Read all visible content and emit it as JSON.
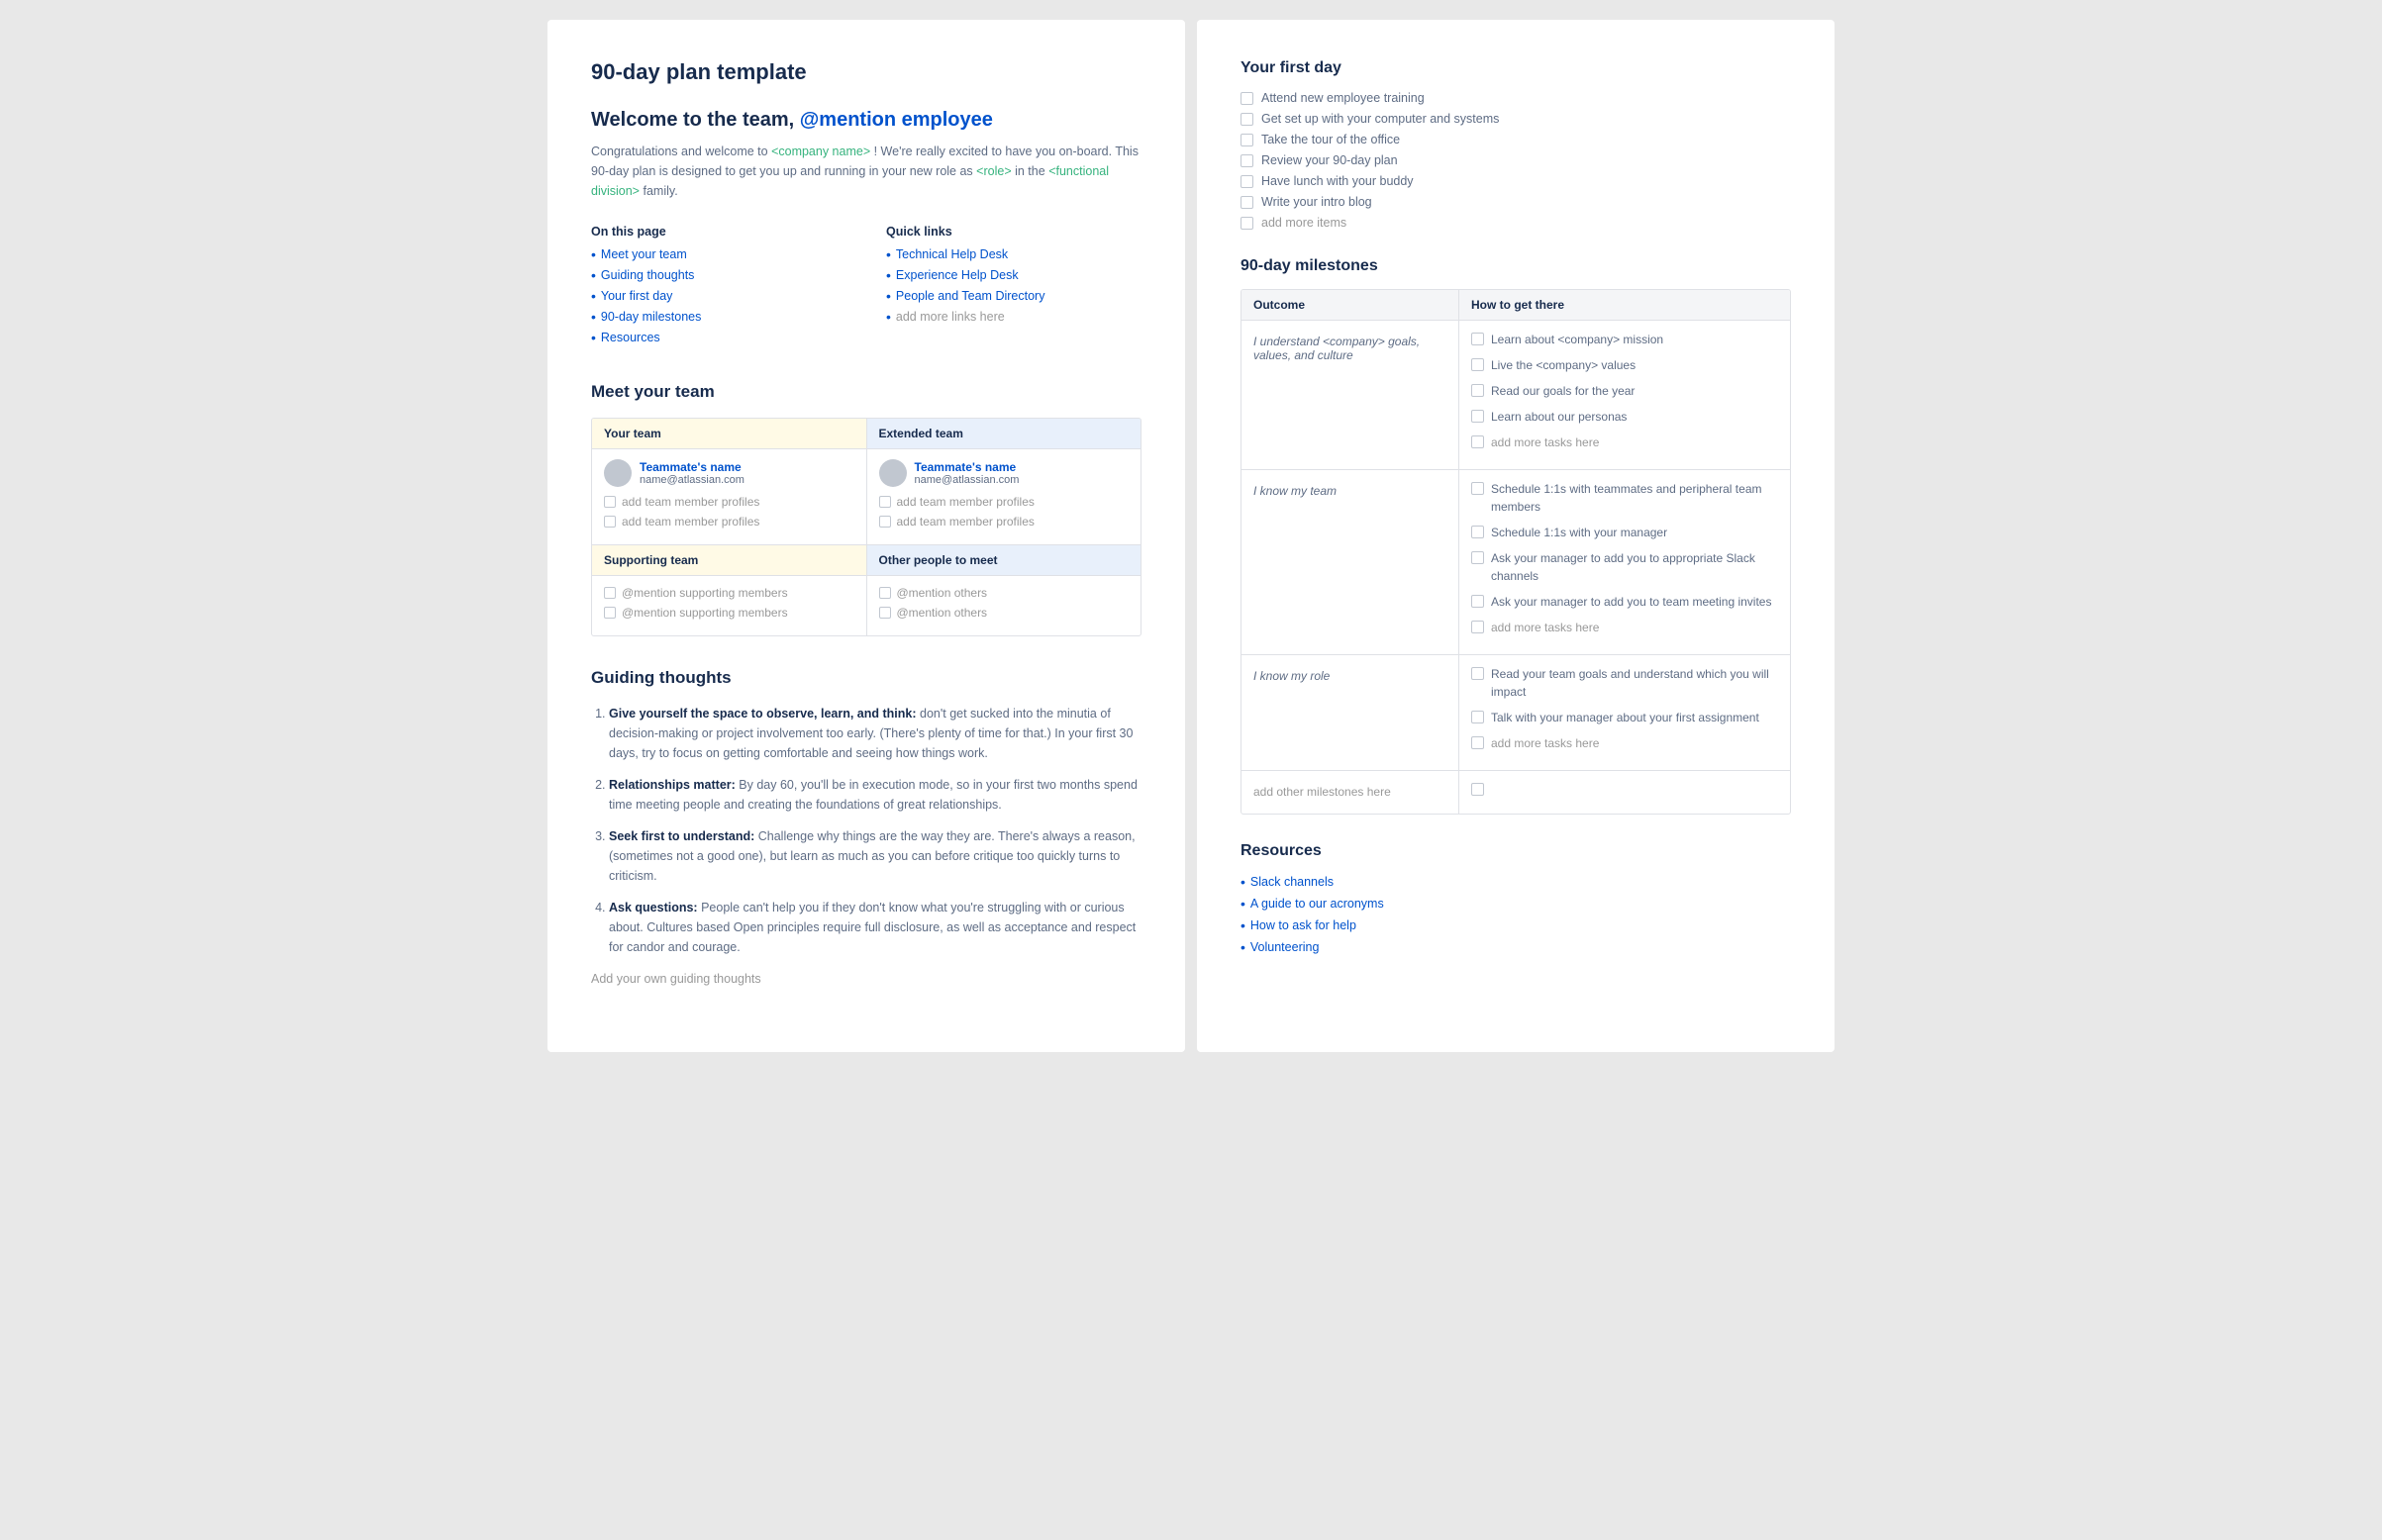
{
  "left": {
    "main_title": "90-day plan template",
    "welcome_title": "Welcome to the team,",
    "welcome_mention": "@mention employee",
    "welcome_desc_1": "Congratulations and welcome to",
    "welcome_tpl_company": "<company name>",
    "welcome_desc_2": "! We're really excited to have you on-board. This 90-day plan is designed to get you up and running in your new role as",
    "welcome_tpl_role": "<role>",
    "welcome_desc_3": "in the",
    "welcome_tpl_division": "<functional division>",
    "welcome_desc_4": "family.",
    "on_this_page_title": "On this page",
    "on_this_page_links": [
      {
        "label": "Meet your team"
      },
      {
        "label": "Guiding thoughts"
      },
      {
        "label": "Your first day"
      },
      {
        "label": "90-day milestones"
      },
      {
        "label": "Resources"
      }
    ],
    "quick_links_title": "Quick links",
    "quick_links": [
      {
        "label": "Technical Help Desk"
      },
      {
        "label": "Experience Help Desk"
      },
      {
        "label": "People and Team Directory"
      },
      {
        "label": "add more links here",
        "muted": true
      }
    ],
    "meet_your_team_title": "Meet your team",
    "team": {
      "your_team_label": "Your team",
      "extended_team_label": "Extended team",
      "supporting_team_label": "Supporting team",
      "other_people_label": "Other people to meet",
      "member1_name": "Teammate's name",
      "member1_email": "name@atlassian.com",
      "member2_name": "Teammate's name",
      "member2_email": "name@atlassian.com",
      "add_member1": "add team member profiles",
      "add_member2": "add team member profiles",
      "mention_support1": "@mention supporting members",
      "mention_support2": "@mention supporting members",
      "mention_other1": "@mention others",
      "mention_other2": "@mention others"
    },
    "guiding_thoughts_title": "Guiding thoughts",
    "guiding_items": [
      {
        "bold": "Give yourself the space to observe, learn, and think:",
        "text": " don't get sucked into the minutia of decision-making or project involvement too early. (There's plenty of time for that.) In your first 30 days, try to focus on getting comfortable and seeing how things work."
      },
      {
        "bold": "Relationships matter:",
        "text": " By day 60, you'll be in execution mode, so in your first two months spend time meeting people and creating the foundations of great relationships."
      },
      {
        "bold": "Seek first to understand:",
        "text": " Challenge why things are the way they are. There's always a reason, (sometimes not a good one), but learn as much as you can before critique too quickly turns to criticism."
      },
      {
        "bold": "Ask questions:",
        "text": " People can't help you if they don't know what you're struggling with or curious about. Cultures based Open principles require full disclosure, as well as acceptance and respect for candor and courage."
      }
    ],
    "add_guiding_thought": "Add your own guiding thoughts"
  },
  "right": {
    "first_day_title": "Your first day",
    "first_day_items": [
      "Attend new employee training",
      "Get set up with your computer and systems",
      "Take the tour of the office",
      "Review your 90-day plan",
      "Have lunch with your buddy",
      "Write your intro blog"
    ],
    "first_day_add": "add more items",
    "milestones_title": "90-day milestones",
    "milestone_outcome_header": "Outcome",
    "milestone_how_header": "How to get there",
    "milestones": [
      {
        "outcome": "I understand <company> goals, values, and culture",
        "tasks": [
          "Learn about <company> mission",
          "Live the <company> values",
          "Read our goals for the year",
          "Learn about our personas"
        ],
        "add_task": "add more tasks here"
      },
      {
        "outcome": "I know my team",
        "tasks": [
          "Schedule 1:1s with teammates and peripheral team members",
          "Schedule 1:1s with your manager",
          "Ask your manager to add you to appropriate Slack channels",
          "Ask your manager to add you to team meeting invites"
        ],
        "add_task": "add more tasks here"
      },
      {
        "outcome": "I know my role",
        "tasks": [
          "Read your team goals and understand which you will impact",
          "Talk with your manager about your first assignment"
        ],
        "add_task": "add more tasks here"
      },
      {
        "outcome": "add other milestones here",
        "tasks": [],
        "add_task": ""
      }
    ],
    "resources_title": "Resources",
    "resources_links": [
      {
        "label": "Slack channels"
      },
      {
        "label": "A guide to our acronyms"
      },
      {
        "label": "How to ask for help"
      },
      {
        "label": "Volunteering"
      }
    ]
  }
}
